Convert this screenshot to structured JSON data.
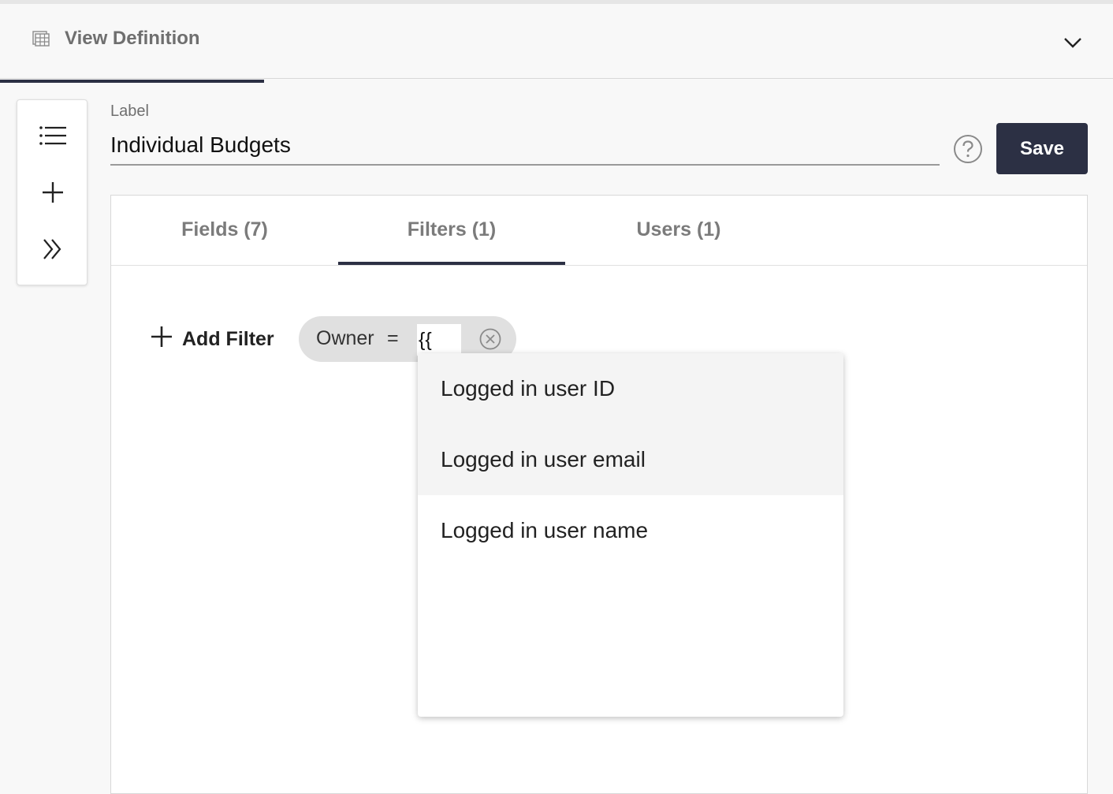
{
  "header": {
    "title": "View Definition",
    "icon": "table-grid-icon",
    "collapse_icon": "chevron-down-icon"
  },
  "toolbar": {
    "items": [
      {
        "name": "list",
        "icon": "list-icon"
      },
      {
        "name": "add",
        "icon": "plus-icon"
      },
      {
        "name": "expand",
        "icon": "double-chevron-right-icon"
      }
    ]
  },
  "label_field": {
    "caption": "Label",
    "value": "Individual Budgets"
  },
  "help_icon": "help-circle-icon",
  "save_label": "Save",
  "tabs": [
    {
      "label": "Fields (7)",
      "active": false
    },
    {
      "label": "Filters (1)",
      "active": true
    },
    {
      "label": "Users (1)",
      "active": false
    }
  ],
  "filters": {
    "add_label": "Add Filter",
    "chip": {
      "field": "Owner",
      "operator": "=",
      "value": "{{"
    }
  },
  "dropdown": {
    "options": [
      {
        "label": "Logged in user ID"
      },
      {
        "label": "Logged in user email"
      },
      {
        "label": "Logged in user name"
      }
    ]
  },
  "colors": {
    "accent": "#2c3044",
    "background": "#f8f8f8",
    "chip": "#e0e0e0"
  }
}
